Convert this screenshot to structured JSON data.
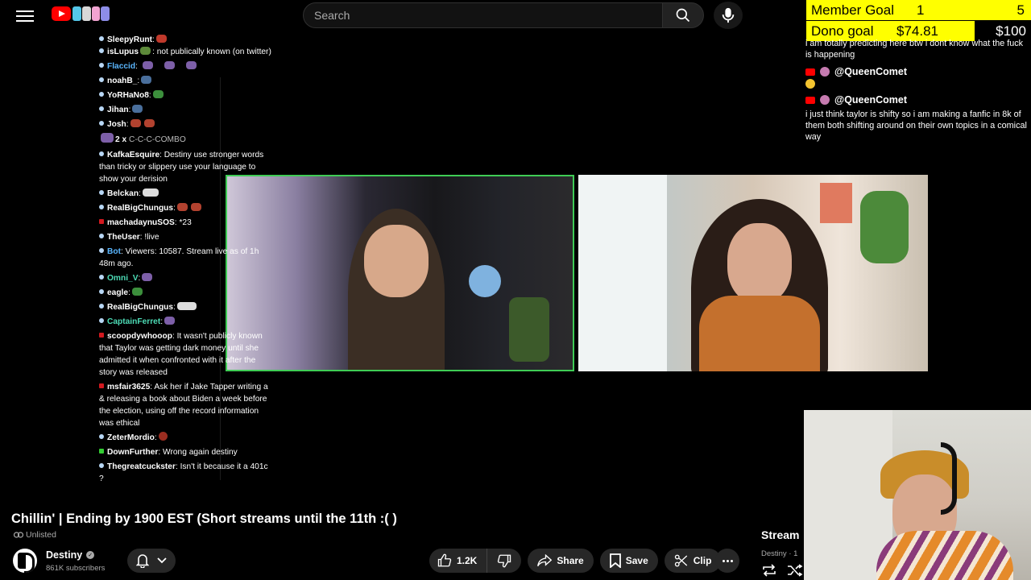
{
  "header": {
    "search_placeholder": "Search",
    "icons": {
      "menu": "hamburger-icon",
      "logo": "youtube-logo",
      "search": "search-icon",
      "mic": "mic-icon"
    }
  },
  "chat": [
    {
      "user": "SleepyRunt",
      "text": ":",
      "dot": "blue",
      "emotes": 1
    },
    {
      "user": "isLupus",
      "text": ": not publically known (on twitter)",
      "dot": "blue",
      "emotes": 1
    },
    {
      "user": "Flaccid",
      "text": ":",
      "dot": "blue",
      "emotes": 3,
      "blue": true
    },
    {
      "user": "noahB_",
      "text": ":",
      "dot": "blue",
      "emotes": 1
    },
    {
      "user": "YoRHaNo8",
      "text": ":",
      "dot": "blue",
      "emotes": 1
    },
    {
      "user": "Jihan",
      "text": ":",
      "dot": "blue",
      "emotes": 1
    },
    {
      "user": "Josh",
      "text": ":",
      "dot": "blue",
      "emotes": 2
    }
  ],
  "combo": {
    "count": "2 x",
    "label": "C-C-C-COMBO"
  },
  "chat2": [
    {
      "user": "KafkaEsquire",
      "text": ": Destiny use stronger words than tricky or slippery  use your language to show your derision",
      "dot": "blue"
    },
    {
      "user": "Belckan",
      "text": ":",
      "dot": "blue"
    },
    {
      "user": "RealBigChungus",
      "text": ":",
      "dot": "blue"
    },
    {
      "user": "machadaynuSOS",
      "text": ": *23",
      "dot": "red"
    },
    {
      "user": "TheUser",
      "text": ": !live",
      "dot": "blue"
    },
    {
      "user": "Bot",
      "text": ": Viewers: 10587. Stream live as of 1h 48m ago.",
      "dot": "blue",
      "blue": true
    },
    {
      "user": "Omni_V",
      "text": ":",
      "dot": "blue",
      "teal": true
    },
    {
      "user": "eagle",
      "text": ":",
      "dot": "blue"
    },
    {
      "user": "RealBigChungus",
      "text": ":",
      "dot": "blue"
    },
    {
      "user": "CaptainFerret",
      "text": ":",
      "dot": "blue",
      "teal": true
    },
    {
      "user": "scoopdywhooop",
      "text": ": It wasn't publicly known that Taylor was getting dark money until she admitted it when confronted with it after the story was released",
      "dot": "red"
    },
    {
      "user": "msfair3625",
      "text": ": Ask her if Jake Tapper writing a & releasing a book about Biden a week before the election, using off the record information was ethical",
      "dot": "red"
    },
    {
      "user": "ZeterMordio",
      "text": ":",
      "dot": "blue"
    },
    {
      "user": "DownFurther",
      "text": ": Wrong again destiny",
      "dot": "green"
    },
    {
      "user": "Thegreatcuckster",
      "text": ": Isn't it because it a 401c ?",
      "dot": "blue"
    }
  ],
  "goals": {
    "member_label": "Member Goal",
    "member_current": "1",
    "member_target": "5",
    "dono_label": "Dono goal",
    "dono_current": "$74.81",
    "dono_target": "$100",
    "dono_progress": 0.7481
  },
  "right_chat": {
    "top_text": "i am totally predicting here btw i dont know what the fuck is happening",
    "handle1": "@QueenComet",
    "handle2": "@QueenComet",
    "msg2": "i just think taylor is shifty so i am making a fanfic in 8k of them both shifting around on their own topics in a comical way"
  },
  "video": {
    "title": "Chillin' | Ending by 1900 EST (Short streams until the 11th :( )",
    "visibility": "Unlisted",
    "channel": "Destiny",
    "subscribers": "861K subscribers",
    "likes": "1.2K",
    "share": "Share",
    "save": "Save",
    "clip": "Clip"
  },
  "side": {
    "title": "Stream",
    "sub": "Destiny · 1"
  },
  "colors": {
    "accent": "#ff0000",
    "goal": "#ffff00",
    "highlight_border": "#3fcc55"
  }
}
